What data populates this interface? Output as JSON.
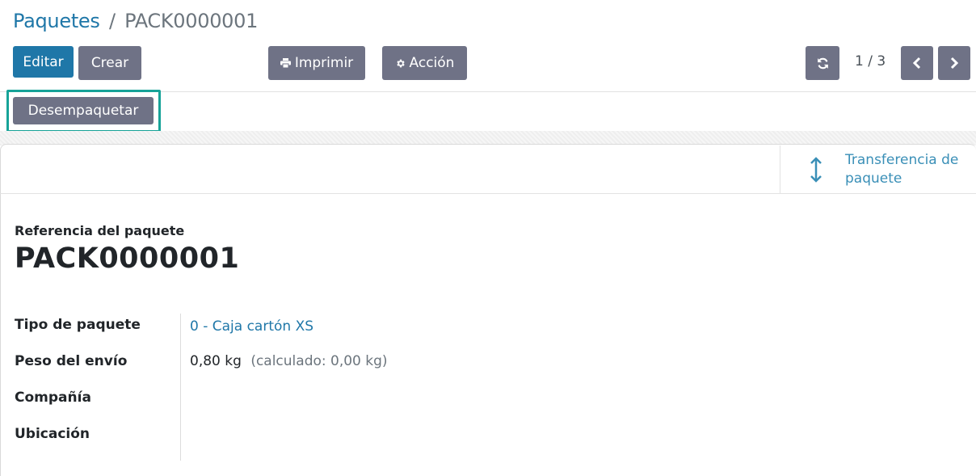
{
  "breadcrumb": {
    "parent": "Paquetes",
    "separator": "/",
    "current": "PACK0000001"
  },
  "toolbar": {
    "edit_label": "Editar",
    "create_label": "Crear",
    "print_label": "Imprimir",
    "action_label": "Acción",
    "print_icon": "printer-icon",
    "action_icon": "gear-icon"
  },
  "pager": {
    "value": "1 / 3",
    "refresh_icon": "refresh-icon",
    "prev_icon": "chevron-left-icon",
    "next_icon": "chevron-right-icon"
  },
  "statusbar": {
    "unpack_label": "Desempaquetar"
  },
  "smart_button": {
    "label_line1": "Transferencia de",
    "label_line2": "paquete",
    "icon": "arrows-vertical-icon"
  },
  "form": {
    "reference_label": "Referencia del paquete",
    "reference_value": "PACK0000001",
    "fields": [
      {
        "label": "Tipo de paquete",
        "value": "0 - Caja cartón XS"
      },
      {
        "label": "Peso del envío",
        "value": "0,80",
        "unit": "kg",
        "computed": "(calculado: 0,00 kg)"
      },
      {
        "label": "Compañía",
        "value": ""
      },
      {
        "label": "Ubicación",
        "value": ""
      }
    ]
  },
  "colors": {
    "primary": "#1f77a8",
    "secondary": "#6f7286",
    "highlight": "#17a398",
    "link": "#1f77a8"
  }
}
